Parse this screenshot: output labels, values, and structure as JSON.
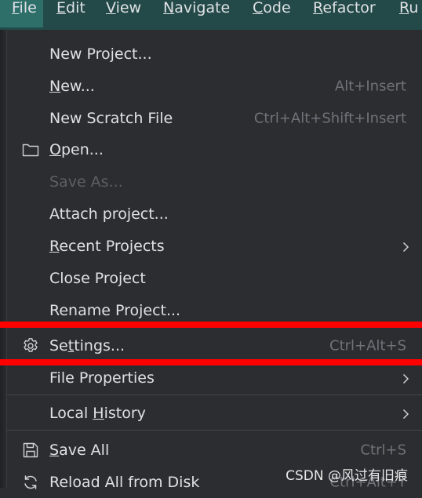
{
  "menubar": {
    "items": [
      {
        "mnemonic": "F",
        "rest": "ile"
      },
      {
        "mnemonic": "E",
        "rest": "dit"
      },
      {
        "mnemonic": "V",
        "rest": "iew"
      },
      {
        "mnemonic": "N",
        "rest": "avigate"
      },
      {
        "mnemonic": "C",
        "rest": "ode"
      },
      {
        "mnemonic": "R",
        "rest": "efactor"
      },
      {
        "mnemonic": "R",
        "rest": "u"
      }
    ]
  },
  "file_menu": {
    "new_project": "New Project...",
    "new": {
      "pre": "",
      "mn": "N",
      "post": "ew...",
      "shortcut": "Alt+Insert"
    },
    "new_scratch": {
      "label": "New Scratch File",
      "shortcut": "Ctrl+Alt+Shift+Insert"
    },
    "open": {
      "pre": "",
      "mn": "O",
      "post": "pen...",
      "icon": "folder-icon"
    },
    "save_as": "Save As...",
    "attach_project": "Attach project...",
    "recent_projects": {
      "pre": "",
      "mn": "R",
      "post": "ecent Projects"
    },
    "close_project": "Close Project",
    "rename_project": "Rename Project...",
    "settings": {
      "pre": "Se",
      "mn": "t",
      "post": "tings...",
      "shortcut": "Ctrl+Alt+S",
      "icon": "gear-icon"
    },
    "file_properties": "File Properties",
    "local_history": {
      "pre": "Local ",
      "mn": "H",
      "post": "istory"
    },
    "save_all": {
      "pre": "",
      "mn": "S",
      "post": "ave All",
      "shortcut": "Ctrl+S",
      "icon": "save-icon"
    },
    "reload_all": {
      "label": "Reload All from Disk",
      "shortcut": "Ctrl+Alt+Y",
      "icon": "reload-icon"
    }
  },
  "colors": {
    "highlight_lines": "#ff0000",
    "menubar": "#234a48",
    "menu_bg": "#2b2d30"
  },
  "watermark": "CSDN @风过有旧痕"
}
